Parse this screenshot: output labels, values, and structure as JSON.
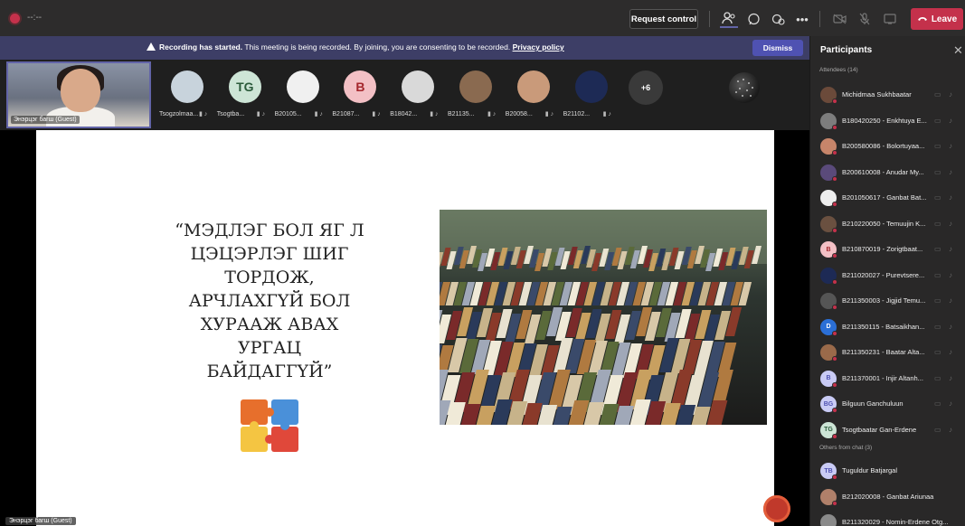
{
  "topbar": {
    "timer": "--:--",
    "request_control": "Request control",
    "leave": "Leave"
  },
  "banner": {
    "bold": "Recording has started.",
    "text": " This meeting is being recorded. By joining, you are consenting to be recorded. ",
    "link": "Privacy policy",
    "dismiss": "Dismiss"
  },
  "self_tile": {
    "label": "Энэрцэг багш (Guest)"
  },
  "strip": {
    "participants": [
      {
        "name": "Tsogzolmaa...",
        "initials": "",
        "color": "#c8d3dc"
      },
      {
        "name": "Tsogtba...",
        "initials": "TG",
        "color": "#cde5d6"
      },
      {
        "name": "B20105...",
        "initials": "",
        "color": "#f0f0f0"
      },
      {
        "name": "B21087...",
        "initials": "B",
        "color": "#f3c0c5"
      },
      {
        "name": "B18042...",
        "initials": "",
        "color": "#d9d9d9"
      },
      {
        "name": "B21135...",
        "initials": "",
        "color": "#8a6a50"
      },
      {
        "name": "B20058...",
        "initials": "",
        "color": "#c99a7a"
      },
      {
        "name": "B21102...",
        "initials": "",
        "color": "#1d2a55"
      }
    ],
    "more": "+6"
  },
  "slide": {
    "quote_lines": [
      "“МЭДЛЭГ БОЛ ЯГ Л",
      "ЦЭЦЭРЛЭГ ШИГ ТОРДОЖ,",
      "АРЧЛАХГҮЙ БОЛ",
      "ХУРААЖ АВАХ",
      "УРГАЦ",
      "БАЙДАГГҮЙ”"
    ],
    "stage_label": "Энэрцэг багш (Guest)"
  },
  "panel": {
    "title": "Participants",
    "attendees_header": "Attendees (14)",
    "others_header": "Others from chat (3)",
    "attendees": [
      {
        "name": "Michidmaa Sukhbaatar",
        "initials": "",
        "color": "#6b4a3a"
      },
      {
        "name": "B180420250 - Enkhtuya E...",
        "initials": "",
        "color": "#7d7d7d"
      },
      {
        "name": "B200580086 - Bolortuyaa...",
        "initials": "",
        "color": "#c7856a"
      },
      {
        "name": "B200610008 - Anudar My...",
        "initials": "",
        "color": "#5a4a7a"
      },
      {
        "name": "B201050617 - Ganbat Bat...",
        "initials": "",
        "color": "#eeeeee"
      },
      {
        "name": "B210220050 - Temuujin K...",
        "initials": "",
        "color": "#6a5040"
      },
      {
        "name": "B210870019 - Zorigtbaat...",
        "initials": "B",
        "color": "#f3c0c5"
      },
      {
        "name": "B211020027 - Purevtsere...",
        "initials": "",
        "color": "#1d2a55"
      },
      {
        "name": "B211350003 - Jigjid Temu...",
        "initials": "",
        "color": "#555555"
      },
      {
        "name": "B211350115 - Batsaikhan...",
        "initials": "D",
        "color": "#2b6fd6"
      },
      {
        "name": "B211350231 - Baatar Alta...",
        "initials": "",
        "color": "#9a6a4a"
      },
      {
        "name": "B211370001 - Injir Altanh...",
        "initials": "B",
        "color": "#c9cbf5"
      },
      {
        "name": "Bilguun Ganchuluun",
        "initials": "BG",
        "color": "#c9cbf5"
      },
      {
        "name": "Tsogtbaatar Gan-Erdene",
        "initials": "TG",
        "color": "#cde5d6"
      }
    ],
    "others": [
      {
        "name": "Tuguldur Batjargal",
        "initials": "TB",
        "color": "#c9cbf5"
      },
      {
        "name": "B212020008 - Ganbat Ariunaa",
        "initials": "",
        "color": "#b0806a"
      },
      {
        "name": "B211320029 - Nomin-Erdene Otg...",
        "initials": "",
        "color": "#8a8a8a"
      }
    ]
  }
}
